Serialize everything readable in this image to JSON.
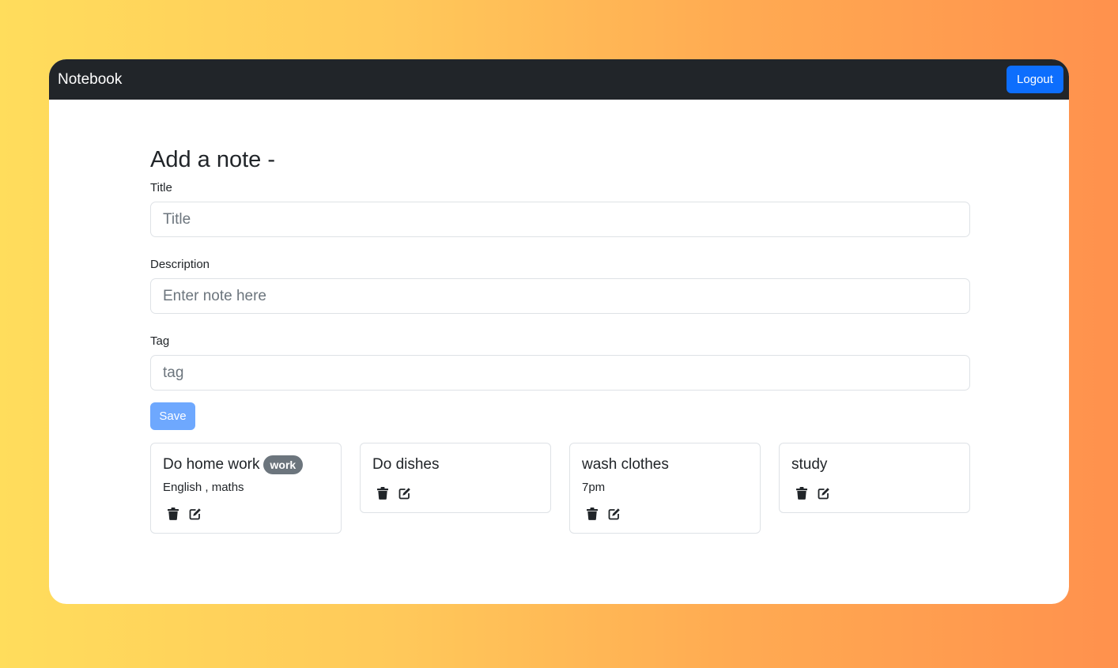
{
  "navbar": {
    "brand": "Notebook",
    "logout_label": "Logout"
  },
  "form": {
    "heading": "Add a note -",
    "title_label": "Title",
    "title_placeholder": "Title",
    "description_label": "Description",
    "description_placeholder": "Enter note here",
    "tag_label": "Tag",
    "tag_placeholder": "tag",
    "save_label": "Save"
  },
  "notes": [
    {
      "title": "Do home work",
      "tag": "work",
      "description": "English , maths"
    },
    {
      "title": "Do dishes",
      "tag": "",
      "description": ""
    },
    {
      "title": "wash clothes",
      "tag": "",
      "description": "7pm"
    },
    {
      "title": "study",
      "tag": "",
      "description": ""
    }
  ],
  "icons": {
    "delete": "trash-icon",
    "edit": "edit-icon"
  },
  "colors": {
    "navbar_bg": "#212529",
    "primary": "#0d6efd",
    "save_disabled": "#6ea8fe",
    "badge": "#6c757d"
  }
}
